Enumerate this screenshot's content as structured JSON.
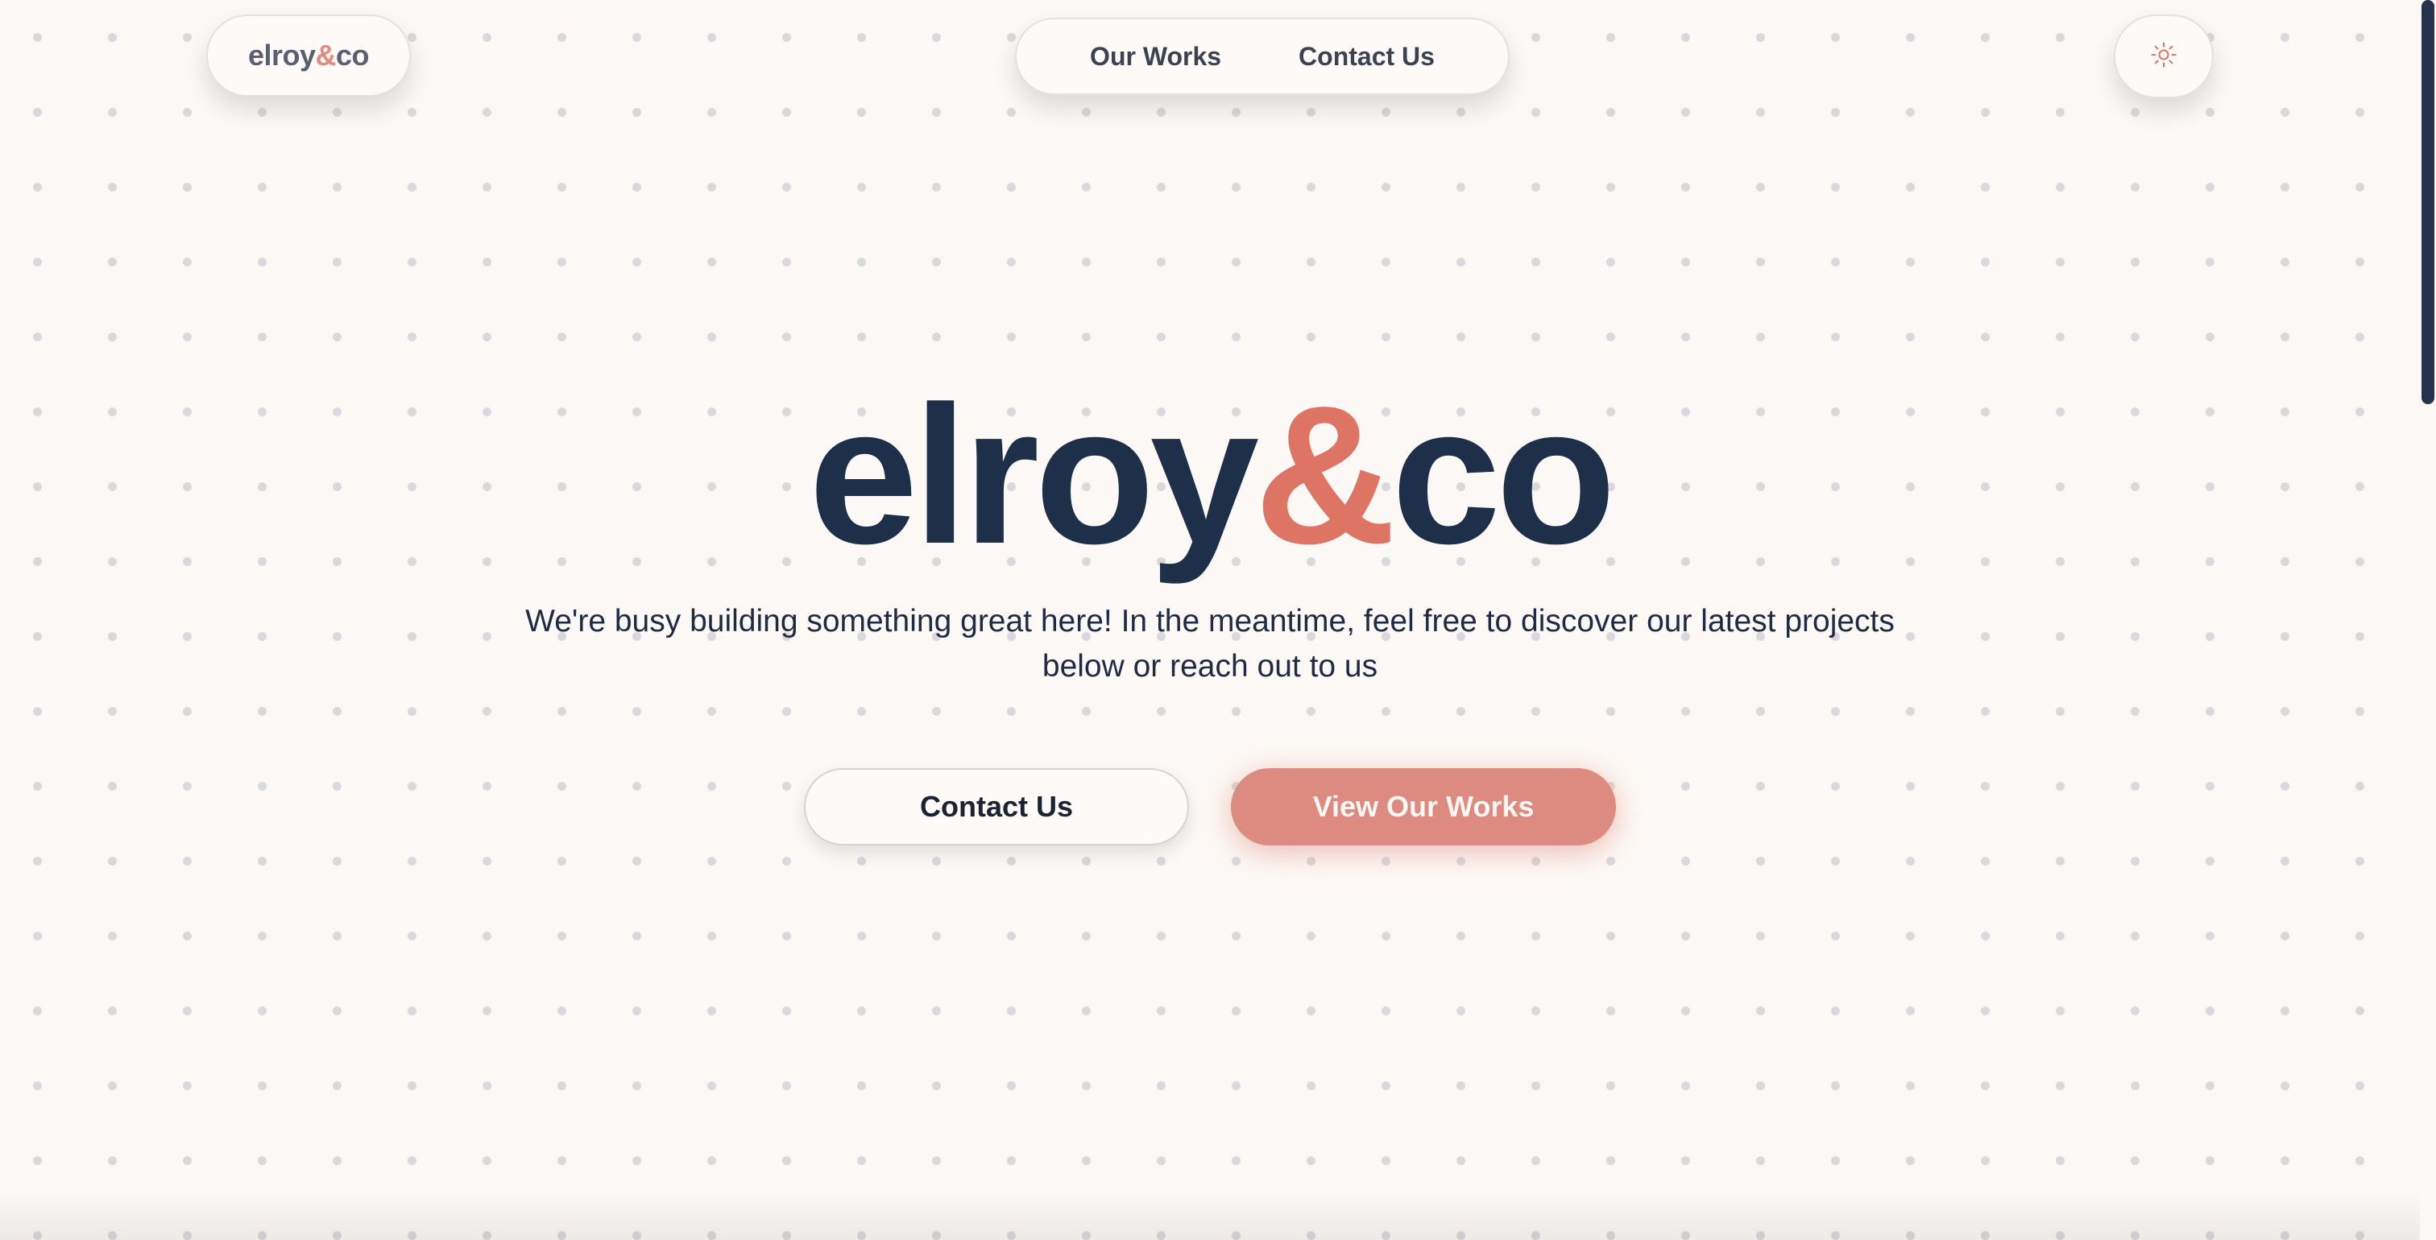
{
  "header": {
    "logo": {
      "part1": "elroy",
      "amp": "&",
      "part2": "co"
    },
    "nav": [
      {
        "label": "Our Works"
      },
      {
        "label": "Contact Us"
      }
    ],
    "theme_toggle_icon": "sun-icon"
  },
  "hero": {
    "title": {
      "part1": "elroy",
      "amp": "&",
      "part2": "co"
    },
    "subtitle_line1": "We're busy building something great here! In the meantime, feel free to discover our latest projects",
    "subtitle_line2": "below or reach out to us",
    "buttons": {
      "contact": "Contact Us",
      "works": "View Our Works"
    }
  },
  "colors": {
    "background": "#fcf8f5",
    "navy": "#1e2f4a",
    "accent": "#de7464",
    "button_accent": "#dd8b80"
  }
}
